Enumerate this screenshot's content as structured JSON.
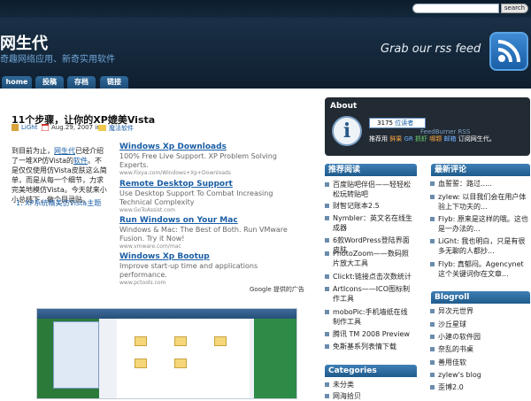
{
  "search": {
    "button_label": "search",
    "value": ""
  },
  "header": {
    "title": "网生代",
    "subtitle": "奇趣网络应用、新奇实用软件",
    "rss_text": "Grab our rss feed"
  },
  "nav": [
    "home",
    "投稿",
    "存档",
    "链接"
  ],
  "post": {
    "title": "11个步骤，让你的XP媲美Vista",
    "author": "LiGht",
    "date": "Aug.29, 2007 in",
    "category": "魔法软件",
    "intro_parts": [
      "到目前为止，",
      "网生代",
      "已经介绍了一堆XP仿Vista的",
      "软件",
      "。不是仅仅使用仿Vista皮肤这么简单，而是从每一个细节，力求完美地模仿Vista。今天就来小小总结下，做个目录贴。"
    ],
    "list_item": "1. XP系统精美仿Vista主题"
  },
  "ads": [
    {
      "title": "Windows Xp Downloads",
      "desc": "100% Free Live Support. XP Problem Solving Experts.",
      "url": "www.Fixya.com/Windows+Xp+Downloads"
    },
    {
      "title": "Remote Desktop Support",
      "desc": "Use Desktop Support To Combat Increasing Technical Complexity",
      "url": "www.GoToAssist.com"
    },
    {
      "title": "Run Windows on Your Mac",
      "desc": "Windows & Mac: The Best of Both. Run VMware Fusion. Try it Now!",
      "url": "www.vmware.com/mac"
    },
    {
      "title": "Windows Xp Bootup",
      "desc": "Improve start-up time and applications performance.",
      "url": "www.pctools.com"
    }
  ],
  "google_label": "Google 提供的广告",
  "about": {
    "title": "About",
    "count": "3175",
    "readers": "位读者",
    "by": "BY FEEDBURNER",
    "feedburner": "FeedBurner RSS",
    "sub_prefix": "推荐用",
    "sub_links": [
      "鲜果",
      "GR",
      "抓虾",
      "哪颗",
      "邮箱"
    ],
    "sub_suffix": "订阅网生代。"
  },
  "recommended": {
    "title": "推荐阅读",
    "items": [
      "百度贴吧伴侣——轻轻松松玩转贴吧",
      "财智记账本2.5",
      "Nymbler：英文名在线生成器",
      "6款WordPress登陆界面皮肤",
      "PhotoZoom——数码照片放大工具",
      "Clickt:链接点击次数统计",
      "ArtIcons——ICO图标制作工具",
      "moboPic:手机墙纸在线制作工具",
      "腾讯 TM 2008 Preview",
      "免斯基系列表情下载"
    ]
  },
  "categories": {
    "title": "Categories",
    "items": [
      "未分类",
      "网海拾贝"
    ]
  },
  "comments": {
    "title": "最新评论",
    "items": [
      "血誓誓：路过.....",
      "zylew: 以目我们会在用户体验上下功夫的...",
      "Flyb: 原来是这样的哦。这也是一办法的...",
      "LiGht: 我也明白，只是有很多无聊的人都抄...",
      "Flyb: 真郁闷。Agencynet 这个关键词你在文章..."
    ]
  },
  "blogroll": {
    "title": "Blogroll",
    "items": [
      "异次元世界",
      "沙丘星球",
      "小建の软件园",
      "奈乱的书桌",
      "善用佳软",
      "zylew's blog",
      "歪博2.0"
    ]
  }
}
